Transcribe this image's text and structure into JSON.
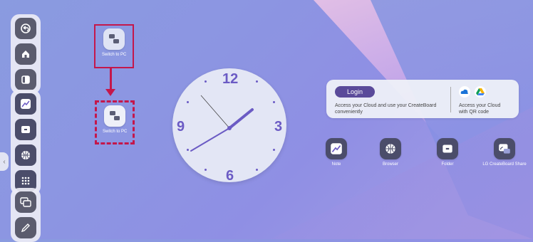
{
  "sidebar": {
    "collapse_icon": "chevron-left-icon",
    "top_buttons": [
      "back-icon",
      "home-icon",
      "overview-icon"
    ],
    "apps": [
      "note-app-icon",
      "folder-app-icon",
      "browser-app-icon",
      "apps-grid-icon"
    ],
    "bottom_buttons": [
      "screen-share-icon",
      "pen-icon"
    ]
  },
  "switch_to_pc": {
    "label": "Switch to PC"
  },
  "clock": {
    "numbers": {
      "twelve": "12",
      "three": "3",
      "six": "6",
      "nine": "9"
    }
  },
  "cloud_card": {
    "login_label": "Login",
    "access_text_line1": "Access your Cloud and use your CreateBoard",
    "access_text_line2": "conveniently",
    "qr_text_line1": "Access your Cloud",
    "qr_text_line2": "with QR code"
  },
  "apps": [
    {
      "label": "Note"
    },
    {
      "label": "Browser"
    },
    {
      "label": "Folder"
    },
    {
      "label": "LG CreateBoard Share"
    }
  ],
  "colors": {
    "accent": "#6b5bc4",
    "highlight": "#c4174b",
    "login": "#5a4a9a"
  }
}
